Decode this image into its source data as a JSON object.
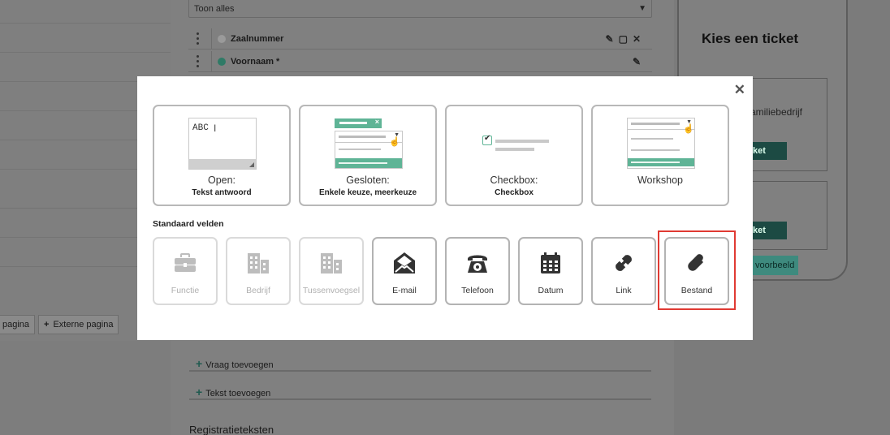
{
  "background": {
    "select_value": "Toon alles",
    "fields": [
      {
        "label": "Zaalnummer",
        "dot_color": "#9a9a9a"
      },
      {
        "label": "Voornaam *",
        "dot_color": "#2f7a66"
      }
    ],
    "phone": {
      "title": "Kies een ticket",
      "card1_text": "amiliebedrijf",
      "card_btn": "ket",
      "preview_btn": "voorbeeld"
    },
    "page_buttons": {
      "internal": "pagina",
      "external": "Externe pagina"
    },
    "add_question": "Vraag toevoegen",
    "add_text": "Tekst toevoegen",
    "registration_title": "Registratieteksten"
  },
  "modal": {
    "close": "✕",
    "question_types": [
      {
        "title": "Open:",
        "subtitle": "Tekst antwoord",
        "icon": "textarea-illustration",
        "sample": "ABC"
      },
      {
        "title": "Gesloten:",
        "subtitle": "Enkele keuze, meerkeuze",
        "icon": "select-illustration"
      },
      {
        "title": "Checkbox:",
        "subtitle": "Checkbox",
        "icon": "checkbox-illustration",
        "check": "✔"
      },
      {
        "title": "Workshop",
        "subtitle": "",
        "icon": "workshop-illustration"
      }
    ],
    "section_label": "Standaard velden",
    "standard_fields": [
      {
        "label": "Functie",
        "icon": "briefcase-icon",
        "disabled": true
      },
      {
        "label": "Bedrijf",
        "icon": "building-icon",
        "disabled": true
      },
      {
        "label": "Tussenvoegsel",
        "icon": "building-icon",
        "disabled": true
      },
      {
        "label": "E-mail",
        "icon": "envelope-icon",
        "disabled": false
      },
      {
        "label": "Telefoon",
        "icon": "phone-icon",
        "disabled": false
      },
      {
        "label": "Datum",
        "icon": "calendar-icon",
        "disabled": false
      },
      {
        "label": "Link",
        "icon": "link-icon",
        "disabled": false
      },
      {
        "label": "Bestand",
        "icon": "paperclip-icon",
        "disabled": false,
        "highlighted": true
      }
    ]
  },
  "colors": {
    "accent_green": "#5fb496",
    "highlight_red": "#e03a33"
  }
}
